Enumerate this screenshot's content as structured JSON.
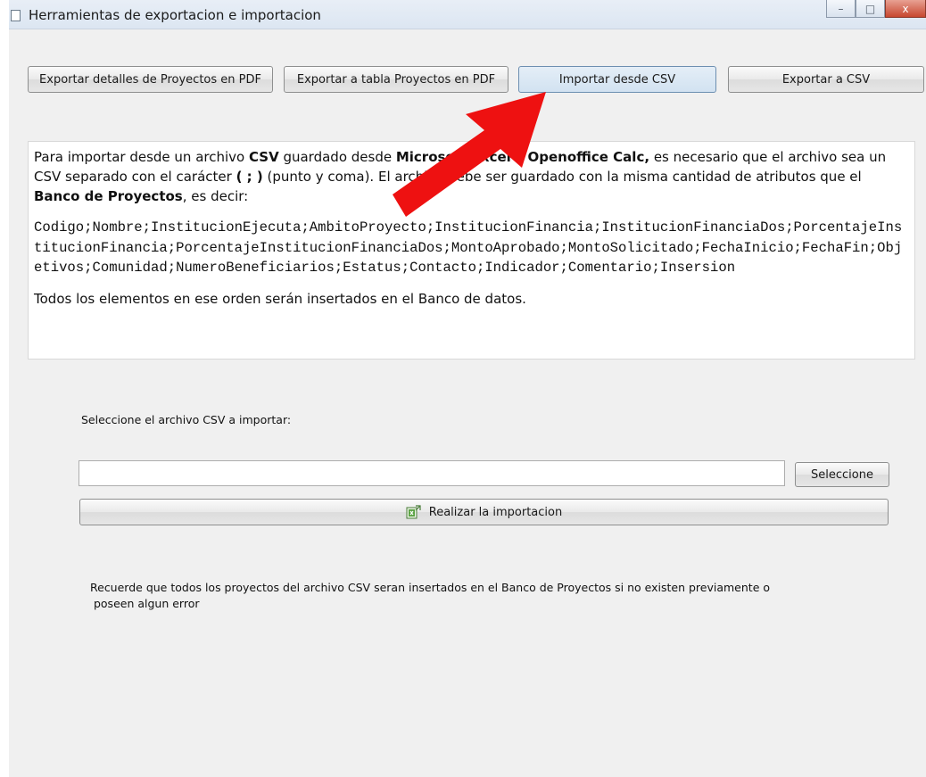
{
  "window": {
    "title": "Herramientas de exportacion e importacion",
    "controls": {
      "minimize": "–",
      "maximize": "□",
      "close": "x"
    }
  },
  "toolbar": {
    "export_pdf_details": "Exportar detalles de Proyectos en PDF",
    "export_pdf_table": "Exportar a tabla  Proyectos en PDF",
    "import_csv": "Importar desde CSV",
    "export_csv": "Exportar a CSV"
  },
  "info": {
    "p1_a": "Para importar desde un archivo ",
    "p1_csv": "CSV",
    "p1_b": " guardado desde ",
    "p1_msexcel": "Microsoft Excel",
    "p1_c": " o ",
    "p1_calc": "Openoffice Calc,",
    "p1_d": " es necesario que el archivo sea un CSV separado con el carácter ",
    "p1_char": "( ; )",
    "p1_e": " (punto y coma). El archivo debe ser guardado con la misma cantidad de atributos que el ",
    "p1_banco": "Banco de Proyectos",
    "p1_f": ", es decir:",
    "fields": "Codigo;Nombre;InstitucionEjecuta;AmbitoProyecto;InstitucionFinancia;InstitucionFinanciaDos;PorcentajeInstitucionFinancia;PorcentajeInstitucionFinanciaDos;MontoAprobado;MontoSolicitado;FechaInicio;FechaFin;Objetivos;Comunidad;NumeroBeneficiarios;Estatus;Contacto;Indicador;Comentario;Insersion",
    "p2": "Todos los elementos en ese orden serán insertados en el Banco de datos."
  },
  "import": {
    "select_label": "Seleccione el archivo CSV a importar:",
    "file_path_value": "",
    "select_button": "Seleccione",
    "run_button": "Realizar la importacion",
    "note_line1": "Recuerde que todos los proyectos del archivo CSV seran insertados en el Banco de Proyectos si no existen previamente o",
    "note_line2": " poseen algun error"
  },
  "colors": {
    "annotation_arrow": "#ee1111",
    "window_bg": "#f0f0f0"
  }
}
